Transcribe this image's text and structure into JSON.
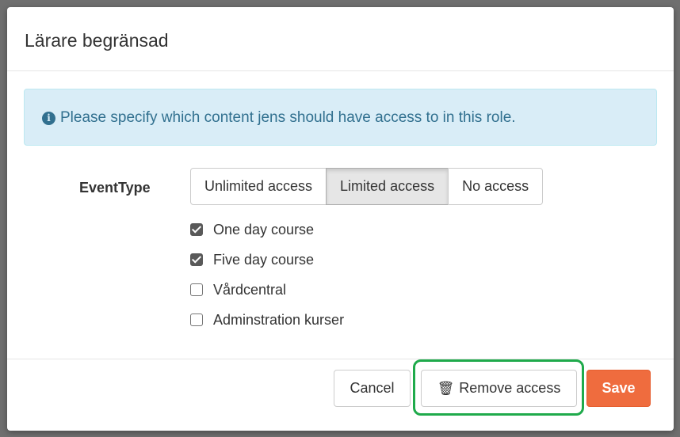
{
  "dialog": {
    "title": "Lärare begränsad",
    "info_message": "Please specify which content jens should have access to in this role.",
    "field_label": "EventType",
    "access_options": [
      "Unlimited access",
      "Limited access",
      "No access"
    ],
    "selected_access": "Limited access",
    "items": [
      {
        "label": "One day course",
        "checked": true
      },
      {
        "label": "Five day course",
        "checked": true
      },
      {
        "label": "Vårdcentral",
        "checked": false
      },
      {
        "label": "Adminstration kurser",
        "checked": false
      }
    ]
  },
  "footer": {
    "cancel_label": "Cancel",
    "remove_label": "Remove access",
    "save_label": "Save"
  },
  "colors": {
    "save_button": "#ef6c3e",
    "info_background": "#d9edf7",
    "highlight": "#1faa4b"
  }
}
